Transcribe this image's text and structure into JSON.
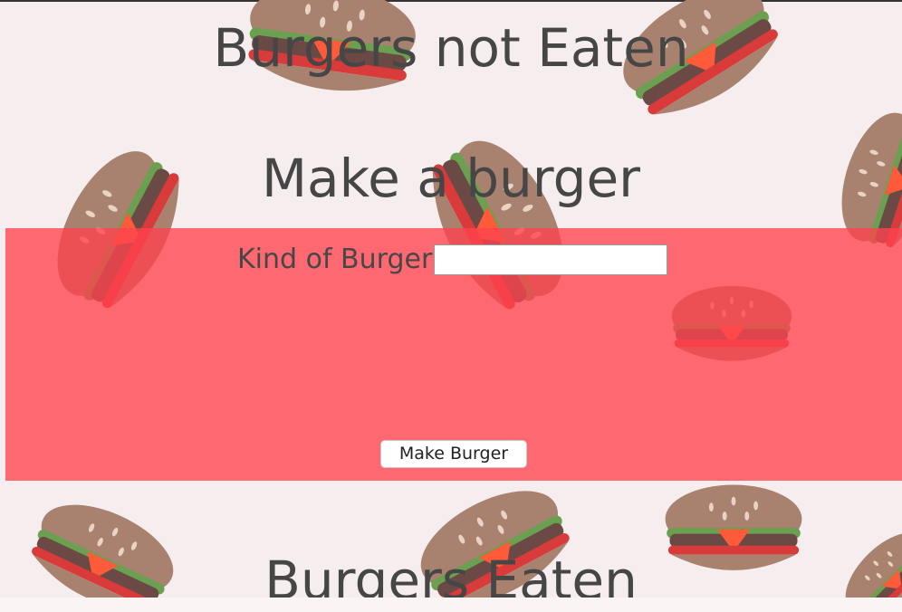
{
  "headings": {
    "not_eaten": "Burgers not Eaten",
    "make": "Make a burger",
    "eaten": "Burgers Eaten"
  },
  "form": {
    "label": "Kind of Burger",
    "input_value": "",
    "button_label": "Make Burger"
  },
  "colors": {
    "page_background": "#f6eeee",
    "form_panel": "#ff424e",
    "heading_text": "#464646"
  },
  "background_pattern": "burger-pattern"
}
